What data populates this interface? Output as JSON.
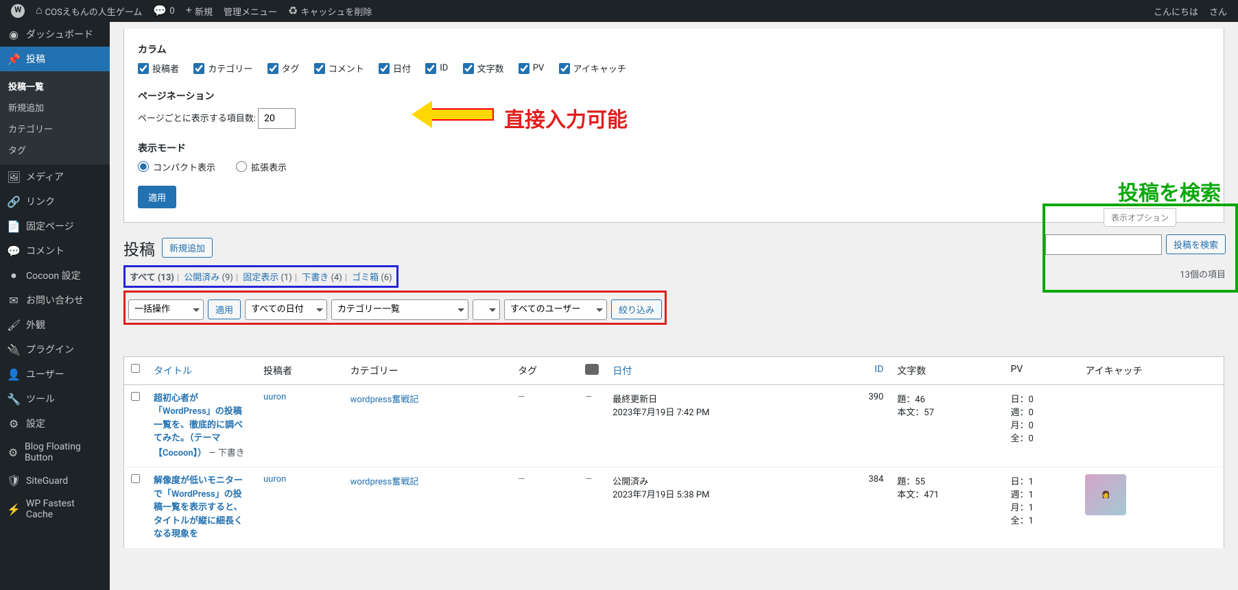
{
  "adminBar": {
    "siteName": "COSえもんの人生ゲーム",
    "commentCount": "0",
    "new": "新規",
    "adminMenu": "管理メニュー",
    "cacheDelete": "キャッシュを削除",
    "greeting": "こんにちは",
    "userSuffix": "さん"
  },
  "sidebar": {
    "dashboard": "ダッシュボード",
    "posts": "投稿",
    "sub": {
      "list": "投稿一覧",
      "new": "新規追加",
      "cat": "カテゴリー",
      "tag": "タグ"
    },
    "media": "メディア",
    "links": "リンク",
    "pages": "固定ページ",
    "comments": "コメント",
    "cocoon": "Cocoon 設定",
    "contact": "お問い合わせ",
    "appearance": "外観",
    "plugins": "プラグイン",
    "users": "ユーザー",
    "tools": "ツール",
    "settings": "設定",
    "blogFloating": "Blog Floating Button",
    "siteguard": "SiteGuard",
    "wpfc": "WP Fastest Cache"
  },
  "screenOptions": {
    "columnsLabel": "カラム",
    "cols": {
      "author": "投稿者",
      "category": "カテゴリー",
      "tag": "タグ",
      "comment": "コメント",
      "date": "日付",
      "id": "ID",
      "chars": "文字数",
      "pv": "PV",
      "eyecatch": "アイキャッチ"
    },
    "paginationLabel": "ページネーション",
    "perPageLabel": "ページごとに表示する項目数:",
    "perPageValue": "20",
    "viewModeLabel": "表示モード",
    "compact": "コンパクト表示",
    "expanded": "拡張表示",
    "apply": "適用"
  },
  "annotations": {
    "direct": "直接入力可能",
    "search": "投稿を検索"
  },
  "heading": {
    "title": "投稿",
    "addNew": "新規追加"
  },
  "subsub": {
    "allLabel": "すべて",
    "allCount": "(13)",
    "pubLabel": "公開済み",
    "pubCount": "(9)",
    "stickyLabel": "固定表示",
    "stickyCount": "(1)",
    "draftLabel": "下書き",
    "draftCount": "(4)",
    "trashLabel": "ゴミ箱",
    "trashCount": "(6)"
  },
  "filters": {
    "bulk": "一括操作",
    "apply": "適用",
    "allDates": "すべての日付",
    "catList": "カテゴリー一覧",
    "allUsers": "すべてのユーザー",
    "narrow": "絞り込み"
  },
  "searchBox": {
    "button": "投稿を検索",
    "displayOptions": "表示オプション"
  },
  "itemCount": "13個の項目",
  "columns": {
    "title": "タイトル",
    "author": "投稿者",
    "category": "カテゴリー",
    "tag": "タグ",
    "date": "日付",
    "id": "ID",
    "chars": "文字数",
    "pv": "PV",
    "eyecatch": "アイキャッチ"
  },
  "rows": [
    {
      "title": "超初心者が「WordPress」の投稿一覧を、徹底的に調べてみた。（テーマ【Cocoon】）",
      "state": "— 下書き",
      "author": "uuron",
      "category": "wordpress奮戦記",
      "tag": "—",
      "comment": "—",
      "dateLine1": "最終更新日",
      "dateLine2": "2023年7月19日 7:42 PM",
      "id": "390",
      "chars1": "題：46",
      "chars2": "本文：57",
      "pv1": "日：0",
      "pv2": "週：0",
      "pv3": "月：0",
      "pv4": "全：0",
      "hasThumb": false
    },
    {
      "title": "解像度が低いモニターで「WordPress」の投稿一覧を表示すると、タイトルが縦に細長くなる現象を",
      "state": "",
      "author": "uuron",
      "category": "wordpress奮戦記",
      "tag": "—",
      "comment": "—",
      "dateLine1": "公開済み",
      "dateLine2": "2023年7月19日 5:38 PM",
      "id": "384",
      "chars1": "題：55",
      "chars2": "本文：471",
      "pv1": "日：1",
      "pv2": "週：1",
      "pv3": "月：1",
      "pv4": "全：1",
      "hasThumb": true
    }
  ]
}
